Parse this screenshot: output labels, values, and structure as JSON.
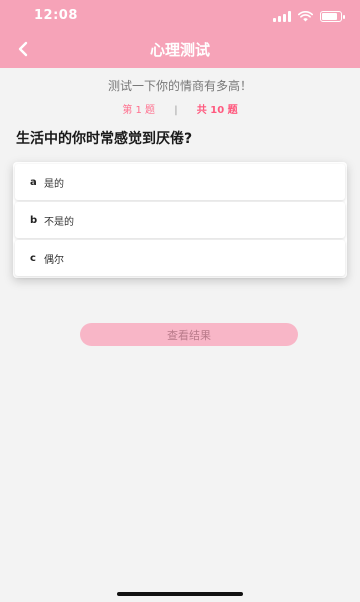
{
  "status_bar": {
    "time": "12:08",
    "icons": [
      "signal-icon",
      "wifi-icon",
      "battery-icon"
    ]
  },
  "nav": {
    "back_icon": "chevron-left-icon",
    "title": "心理测试"
  },
  "quiz": {
    "subtitle": "测试一下你的情商有多高！",
    "current_label": "第 1 题",
    "separator": "|",
    "total_label": "共 10 题",
    "question": "生活中的你时常感觉到厌倦?",
    "options": [
      {
        "letter": "a",
        "text": "是的"
      },
      {
        "letter": "b",
        "text": "不是的"
      },
      {
        "letter": "c",
        "text": "偶尔"
      }
    ]
  },
  "result_button_label": "查看结果",
  "colors": {
    "header": "#f6a3b8",
    "accent": "#ff6f8e",
    "button": "#f8b6c7",
    "background": "#f3f3f3"
  }
}
